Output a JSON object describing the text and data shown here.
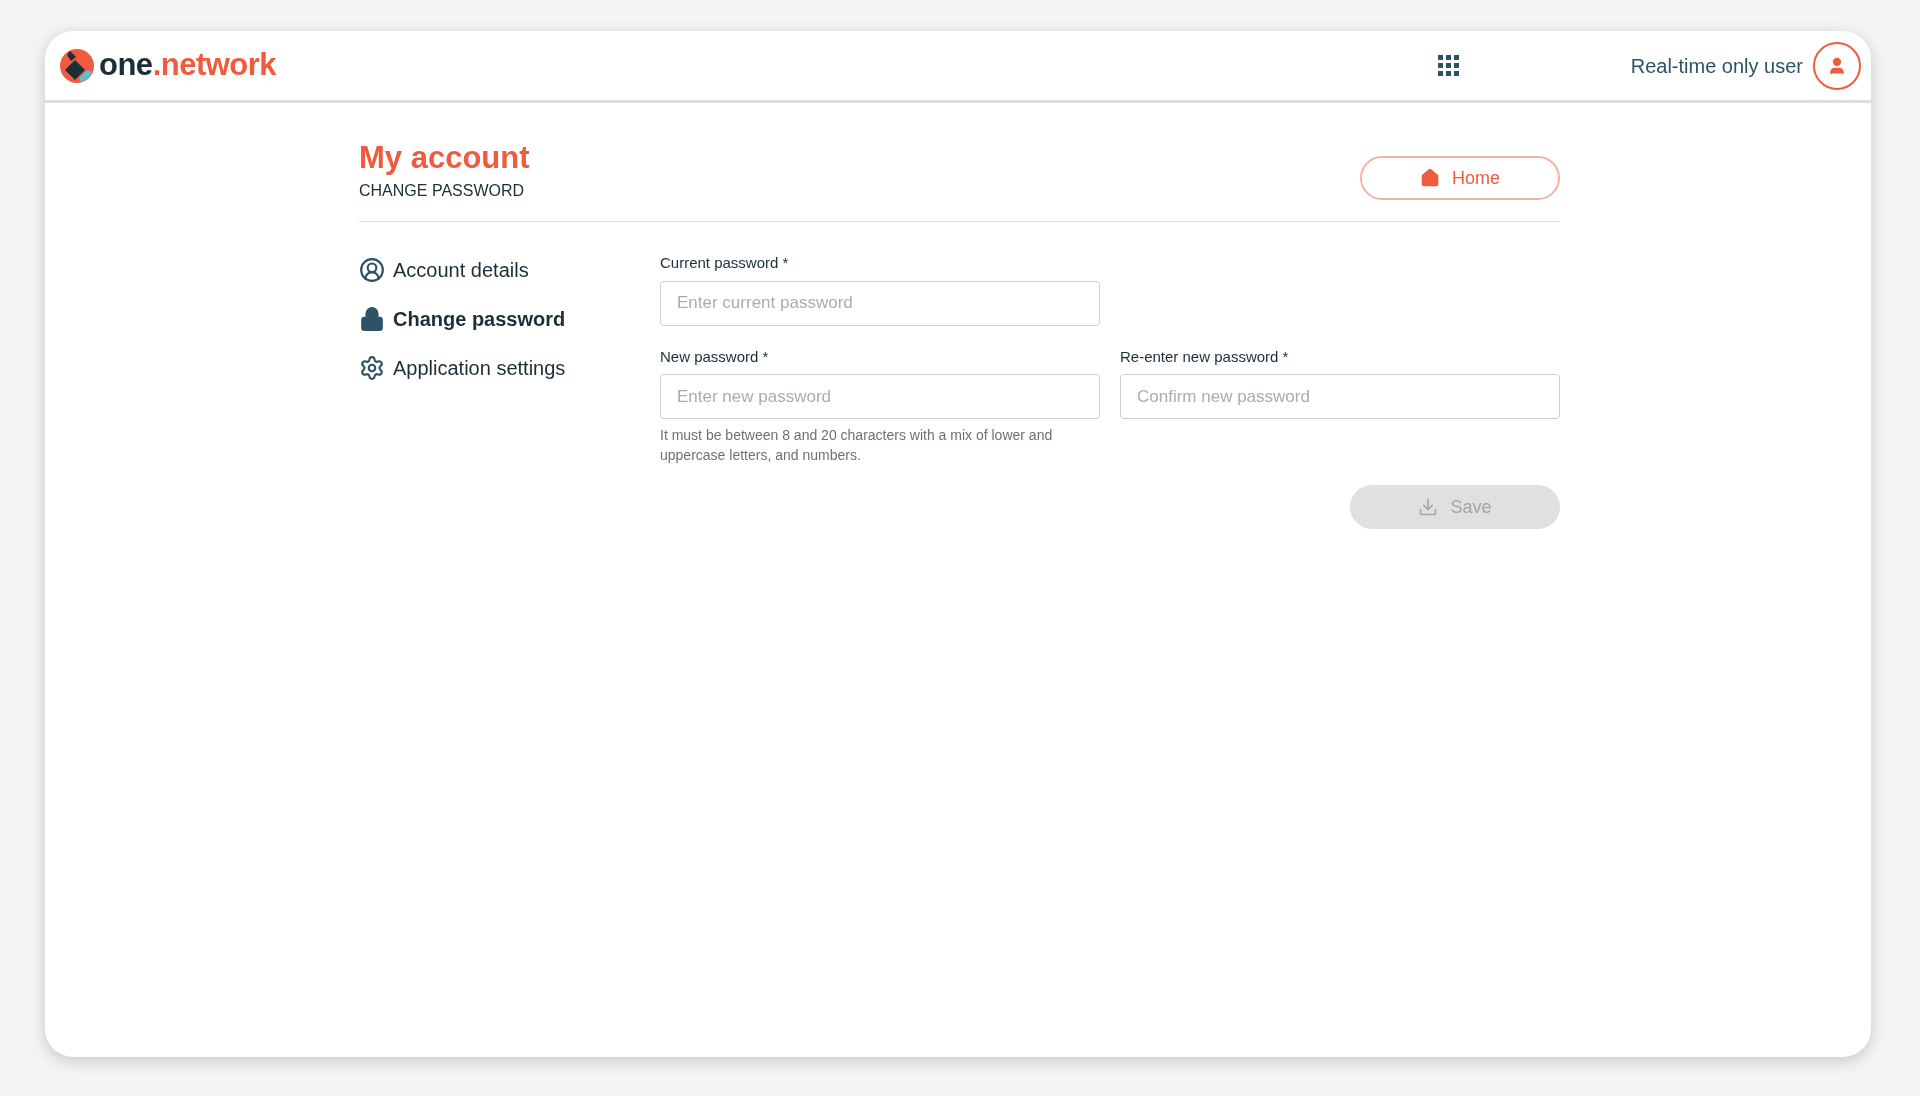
{
  "header": {
    "logo": {
      "main": "one",
      "accent": ".network"
    },
    "user_name": "Real-time only user"
  },
  "page": {
    "title": "My account",
    "subtitle": "CHANGE PASSWORD",
    "home_button": "Home"
  },
  "sidebar": {
    "items": [
      {
        "label": "Account details",
        "kind": "user",
        "selected": false
      },
      {
        "label": "Change password",
        "kind": "lock",
        "selected": true
      },
      {
        "label": "Application settings",
        "kind": "gear",
        "selected": false
      }
    ]
  },
  "form": {
    "fields": [
      {
        "label": "Current password *",
        "placeholder": "Enter current password"
      },
      {
        "label": "New password *",
        "placeholder": "Enter new password",
        "hint": "It must be between 8 and 20 characters with a mix of lower and uppercase letters, and numbers."
      },
      {
        "label": "Re-enter new password *",
        "placeholder": "Confirm new password"
      }
    ],
    "save_button": {
      "label": "Save",
      "disabled": true
    }
  }
}
